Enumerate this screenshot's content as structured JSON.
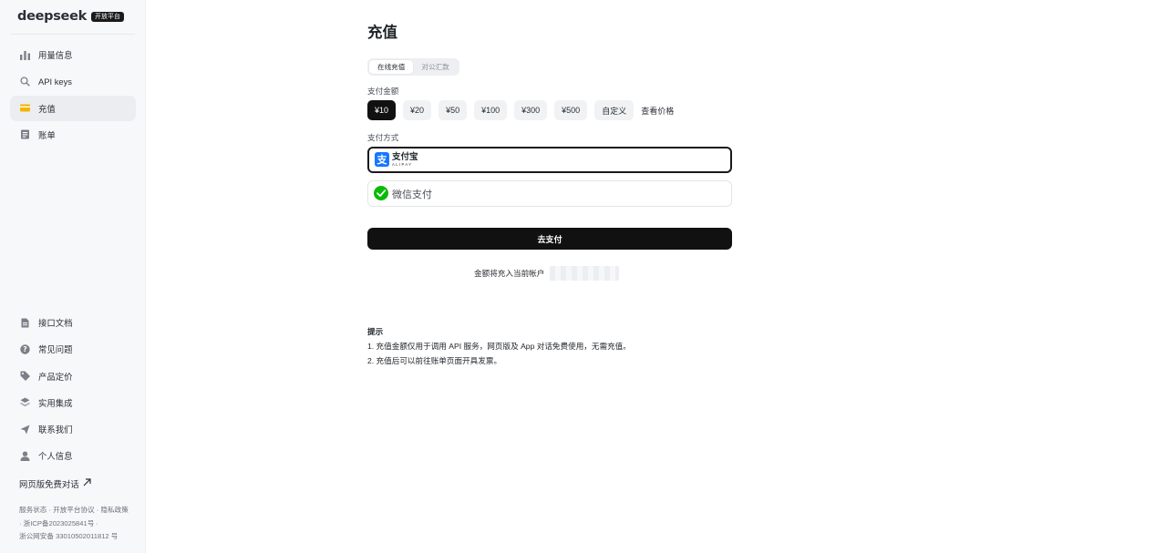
{
  "brand": {
    "name": "deepseek",
    "badge": "开放平台"
  },
  "sidebar": {
    "top_items": [
      {
        "label": "用量信息",
        "icon": "bar-chart-icon"
      },
      {
        "label": "API keys",
        "icon": "search-icon"
      },
      {
        "label": "充值",
        "icon": "wallet-icon",
        "active": true
      },
      {
        "label": "账单",
        "icon": "receipt-icon"
      }
    ],
    "bottom_items": [
      {
        "label": "接口文档",
        "icon": "document-icon"
      },
      {
        "label": "常见问题",
        "icon": "question-icon"
      },
      {
        "label": "产品定价",
        "icon": "tag-icon"
      },
      {
        "label": "实用集成",
        "icon": "layers-icon"
      },
      {
        "label": "联系我们",
        "icon": "send-icon"
      },
      {
        "label": "个人信息",
        "icon": "user-icon"
      }
    ],
    "web_chat_link": "网页版免费对话",
    "footer_line1": "服务状态 · 开放平台协议 · 隐私政策",
    "footer_line2": "· 浙ICP备2023025841号 ·",
    "footer_line3": "浙公网安备 33010502011812 号"
  },
  "main": {
    "title": "充值",
    "tabs": [
      "在线充值",
      "对公汇款"
    ],
    "amount_label": "支付金额",
    "amounts": [
      "¥10",
      "¥20",
      "¥50",
      "¥100",
      "¥300",
      "¥500",
      "自定义"
    ],
    "price_link": "查看价格",
    "method_label": "支付方式",
    "methods": {
      "alipay_cn": "支付宝",
      "alipay_en": "ALIPAY",
      "wechat": "微信支付"
    },
    "pay_button": "去支付",
    "account_note": "金额将充入当前帐户",
    "tips_title": "提示",
    "tip1": "1. 充值金额仅用于调用 API 服务，网页版及 App 对话免费使用，无需充值。",
    "tip2": "2. 充值后可以前往账单页面开具发票。"
  },
  "colors": {
    "accent": "#111111",
    "alipay": "#1677ff",
    "wechat": "#09bb07"
  }
}
